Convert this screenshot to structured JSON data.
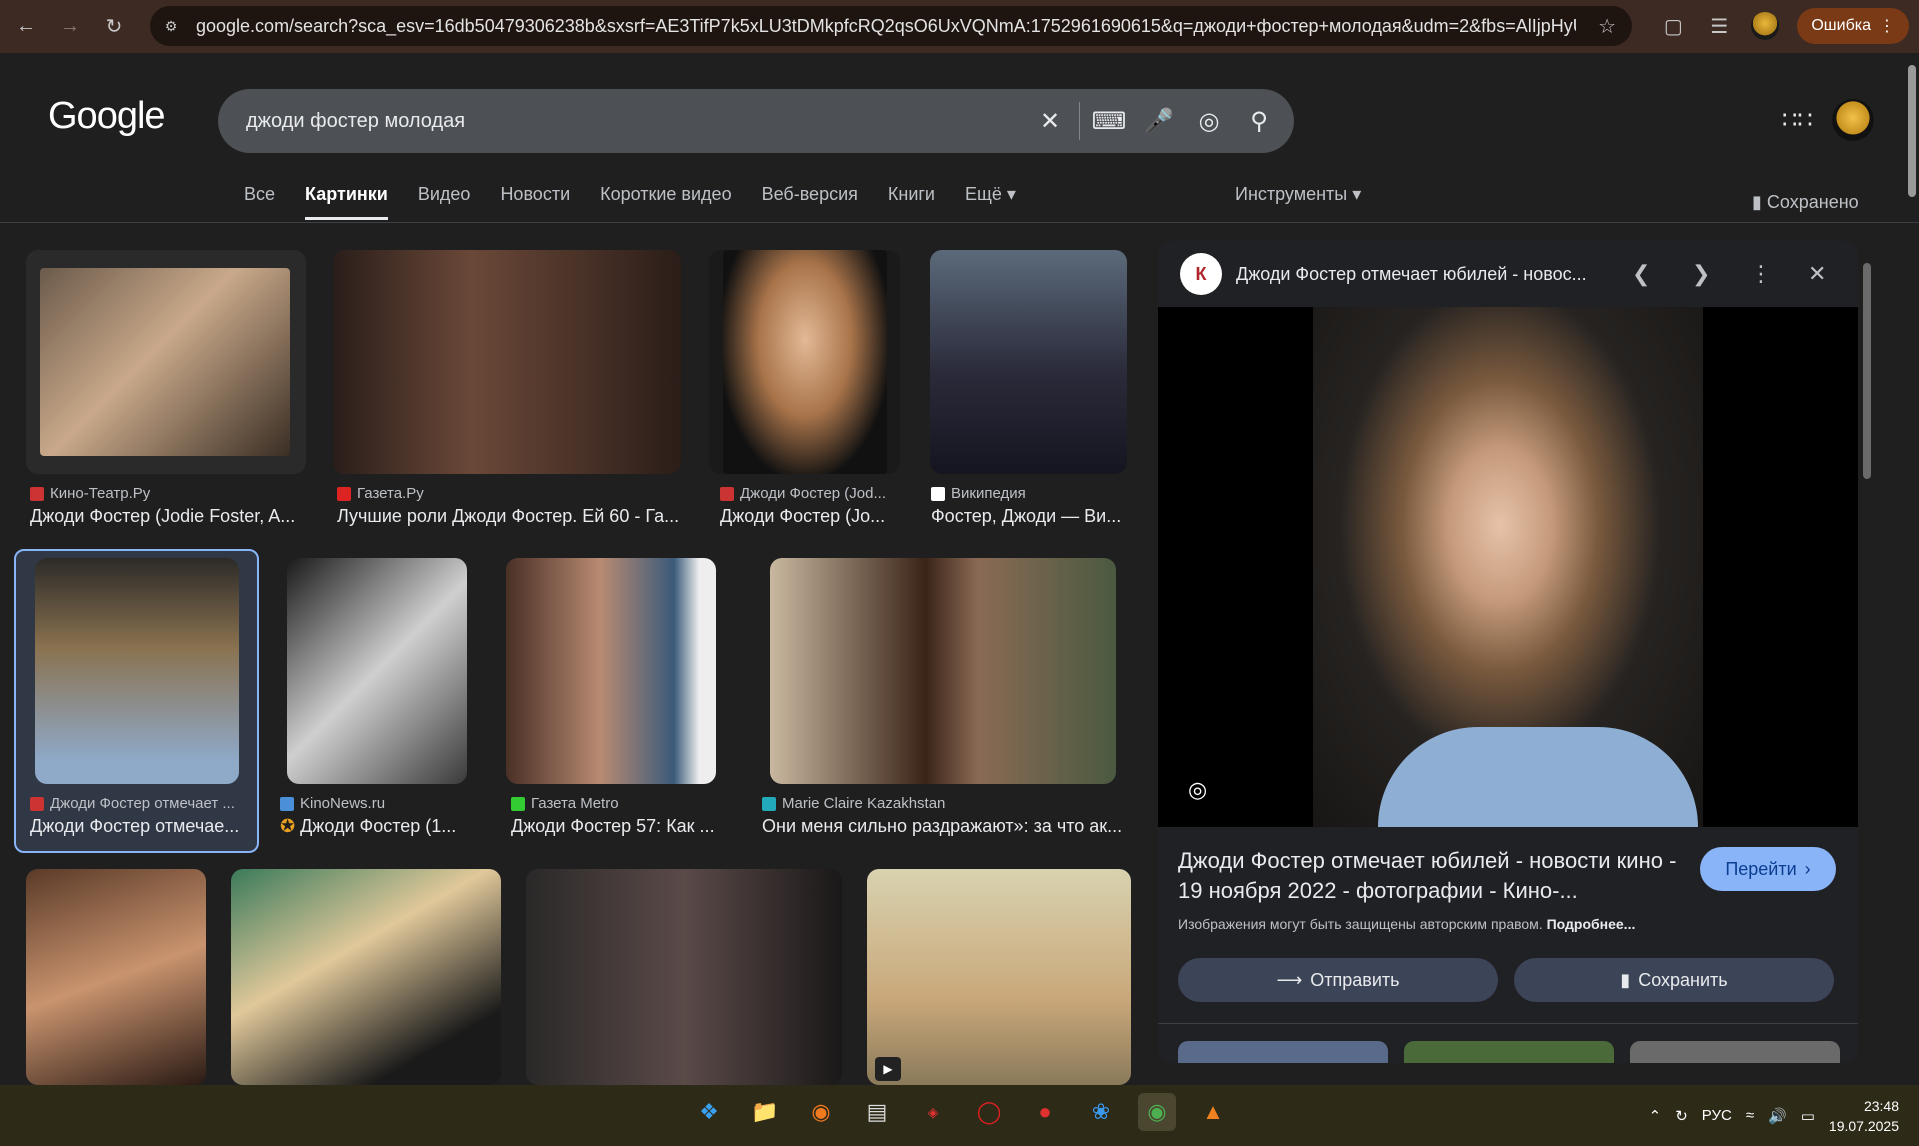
{
  "browser": {
    "url": "google.com/search?sca_esv=16db50479306238b&sxsrf=AE3TifP7k5xLU3tDMkpfcRQ2qsO6UxVQNmA:1752961690615&q=джоди+фостер+молодая&udm=2&fbs=AlIjpHyUpTfR...",
    "error_label": "Ошибка"
  },
  "google": {
    "logo": "Google",
    "query": "джоди фостер молодая",
    "tabs": [
      "Все",
      "Картинки",
      "Видео",
      "Новости",
      "Короткие видео",
      "Веб-версия",
      "Книги",
      "Ещё"
    ],
    "tools": "Инструменты",
    "saved": "Сохранено"
  },
  "results": [
    {
      "source": "Кино-Театр.Ру",
      "title": "Джоди Фостер (Jodie Foster, A...",
      "fav": "#c33"
    },
    {
      "source": "Газета.Ру",
      "title": "Лучшие роли Джоди Фостер. Ей 60 - Га...",
      "fav": "#d22"
    },
    {
      "source": "Джоди Фостер (Jod...",
      "title": "Джоди Фостер (Jo...",
      "fav": "#c33"
    },
    {
      "source": "Википедия",
      "title": "Фостер, Джоди — Ви...",
      "fav": "#fff"
    },
    {
      "source": "Джоди Фостер отмечает ...",
      "title": "Джоди Фостер отмечае...",
      "fav": "#c33"
    },
    {
      "source": "KinoNews.ru",
      "title": "Джоди Фостер (1...",
      "fav": "#4a8fd8"
    },
    {
      "source": "Газета Metro",
      "title": "Джоди Фостер 57: Как ...",
      "fav": "#3c3"
    },
    {
      "source": "Marie Claire Kazakhstan",
      "title": "Они меня сильно раздражают»: за что ак...",
      "fav": "#2ab"
    }
  ],
  "panel": {
    "logo": "К",
    "header_title": "Джоди Фостер отмечает юбилей - новос...",
    "caption": "Джоди Фостер отмечает юбилей - новости кино - 19 ноября 2022 - фотографии - Кино-...",
    "go_label": "Перейти",
    "copyright": "Изображения могут быть защищены авторским правом.",
    "more_link": "Подробнее...",
    "share_label": "Отправить",
    "save_label": "Сохранить"
  },
  "taskbar": {
    "lang": "РУС",
    "time": "23:48",
    "date": "19.07.2025"
  },
  "colors": {
    "accent": "#8ab4f8",
    "background": "#1f1f1f",
    "error": "#7a3a16"
  }
}
